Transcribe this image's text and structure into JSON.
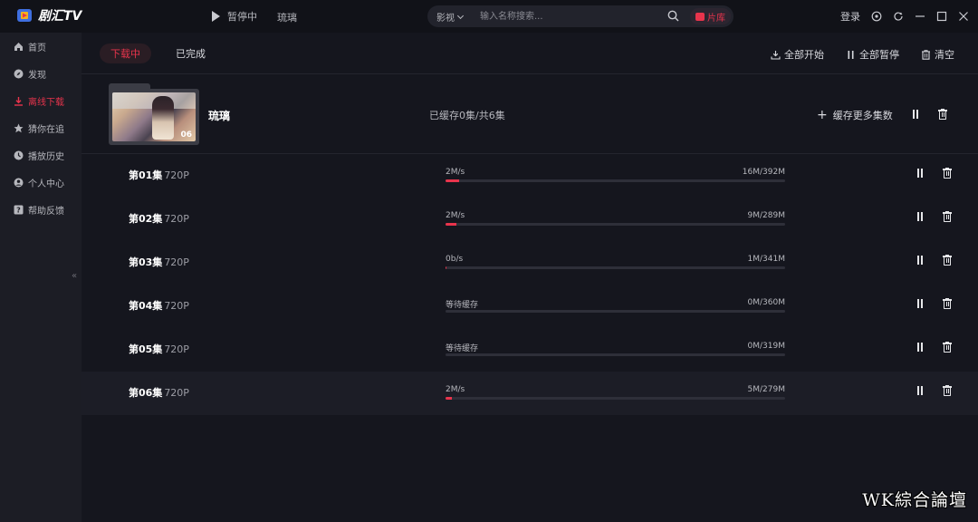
{
  "app": {
    "name": "剧汇TV",
    "pause_status": "暂停中",
    "now_title": "琉璃"
  },
  "search": {
    "category": "影视",
    "placeholder": "输入名称搜索...",
    "library_label": "片库"
  },
  "window": {
    "login_label": "登录"
  },
  "sidebar": {
    "items": [
      {
        "label": "首页",
        "icon": "home-icon"
      },
      {
        "label": "发现",
        "icon": "compass-icon"
      },
      {
        "label": "离线下载",
        "icon": "download-icon",
        "active": true
      },
      {
        "label": "猜你在追",
        "icon": "star-icon"
      },
      {
        "label": "播放历史",
        "icon": "clock-icon"
      },
      {
        "label": "个人中心",
        "icon": "user-icon"
      },
      {
        "label": "帮助反馈",
        "icon": "help-icon"
      }
    ],
    "collapse_glyph": "«"
  },
  "tabs": [
    {
      "label": "下载中",
      "active": true
    },
    {
      "label": "已完成",
      "active": false
    }
  ],
  "toolbar": {
    "start_all": "全部开始",
    "pause_all": "全部暂停",
    "clear": "清空"
  },
  "show": {
    "title": "琉璃",
    "status": "已缓存0集/共6集",
    "episode_badge": "06",
    "more_label": "缓存更多集数"
  },
  "episodes": [
    {
      "name": "第01集",
      "quality": "720P",
      "speed": "2M/s",
      "size": "16M/392M",
      "progress": 0.041
    },
    {
      "name": "第02集",
      "quality": "720P",
      "speed": "2M/s",
      "size": "9M/289M",
      "progress": 0.031
    },
    {
      "name": "第03集",
      "quality": "720P",
      "speed": "0b/s",
      "size": "1M/341M",
      "progress": 0.003
    },
    {
      "name": "第04集",
      "quality": "720P",
      "speed": "等待缓存",
      "size": "0M/360M",
      "progress": 0
    },
    {
      "name": "第05集",
      "quality": "720P",
      "speed": "等待缓存",
      "size": "0M/319M",
      "progress": 0
    },
    {
      "name": "第06集",
      "quality": "720P",
      "speed": "2M/s",
      "size": "5M/279M",
      "progress": 0.018
    }
  ],
  "colors": {
    "accent": "#e8344c",
    "background": "#15161e",
    "sidebar": "#1c1d25"
  },
  "watermark": "WK綜合論壇"
}
